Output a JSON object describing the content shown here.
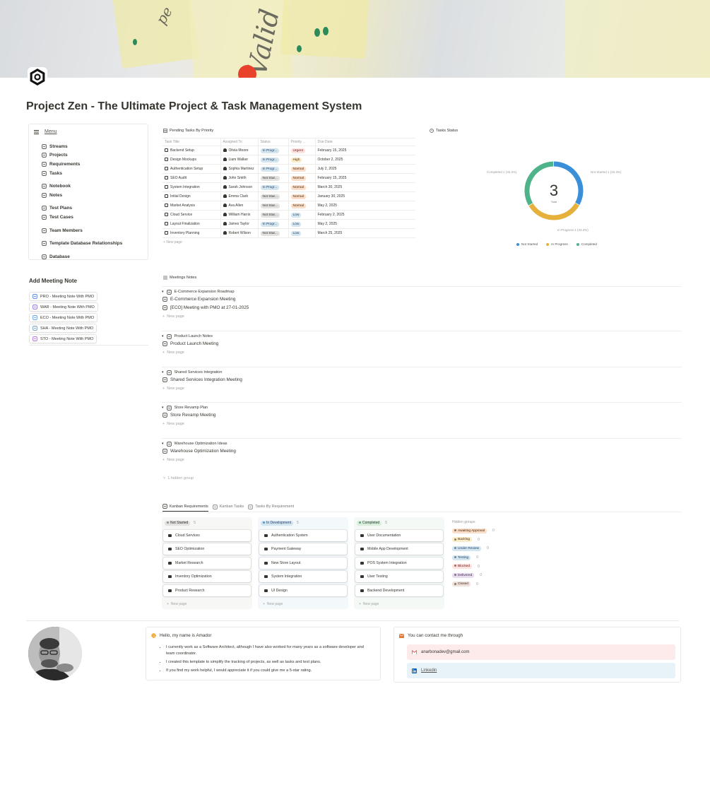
{
  "page": {
    "title": "Project Zen - The Ultimate Project & Task Management System"
  },
  "menu": {
    "label": "Menu",
    "groups": [
      [
        "Streams",
        "Projects",
        "Requirements",
        "Tasks"
      ],
      [
        "Notebook",
        "Notes"
      ],
      [
        "Test Plans",
        "Test Cases"
      ],
      [
        "Team Members"
      ],
      [
        "Template Database Relationships"
      ],
      [
        "Database"
      ]
    ]
  },
  "add_meeting_note": {
    "title": "Add Meeting Note",
    "buttons": [
      "PRO - Meeting Note With PMO",
      "WAR - Meeting Note With PMO",
      "ECO - Meeting Note With PMO",
      "SHA - Meeting Note With PMO",
      "STO - Meeting Note With PMO"
    ]
  },
  "pending_tasks": {
    "view_title": "Pending Tasks By Priority",
    "columns": [
      "Task Title",
      "Assigned To",
      "Status",
      "Priority ...",
      "Due Date"
    ],
    "rows": [
      {
        "title": "Backend Setup",
        "assignee": "Olivia Moore",
        "status": "In Progr...",
        "status_kind": "inprog",
        "priority": "Urgent",
        "priority_kind": "urgent",
        "due": "February 15, 2025"
      },
      {
        "title": "Design Mockups",
        "assignee": "Liam Walker",
        "status": "In Progr...",
        "status_kind": "inprog",
        "priority": "High",
        "priority_kind": "high",
        "due": "October 2, 2025"
      },
      {
        "title": "Authentication Setup",
        "assignee": "Sophia Martinez",
        "status": "In Progr...",
        "status_kind": "inprog",
        "priority": "Normal",
        "priority_kind": "normal",
        "due": "July 2, 2025"
      },
      {
        "title": "SEO Audit",
        "assignee": "John Smith",
        "status": "Not Star...",
        "status_kind": "notstart",
        "priority": "Normal",
        "priority_kind": "normal",
        "due": "February 15, 2025"
      },
      {
        "title": "System Integration",
        "assignee": "Sarah Johnson",
        "status": "In Progr...",
        "status_kind": "inprog",
        "priority": "Normal",
        "priority_kind": "normal",
        "due": "March 30, 2025"
      },
      {
        "title": "Initial Design",
        "assignee": "Emma Clark",
        "status": "Not Star...",
        "status_kind": "notstart",
        "priority": "Normal",
        "priority_kind": "normal",
        "due": "January 30, 2025"
      },
      {
        "title": "Market Analysis",
        "assignee": "Ava Allen",
        "status": "Not Star...",
        "status_kind": "notstart",
        "priority": "Normal",
        "priority_kind": "normal",
        "due": "May 2, 2025"
      },
      {
        "title": "Cloud Service",
        "assignee": "William Harris",
        "status": "Not Star...",
        "status_kind": "notstart",
        "priority": "Low",
        "priority_kind": "low",
        "due": "February 2, 2025"
      },
      {
        "title": "Layout Finalization",
        "assignee": "James Taylor",
        "status": "In Progr...",
        "status_kind": "inprog",
        "priority": "Low",
        "priority_kind": "low",
        "due": "May 2, 2025"
      },
      {
        "title": "Inventory Planning",
        "assignee": "Robert Wilson",
        "status": "Not Star...",
        "status_kind": "notstart",
        "priority": "Low",
        "priority_kind": "low",
        "due": "March 25, 2025"
      }
    ],
    "new_page": "New page"
  },
  "tasks_status": {
    "view_title": "Tasks Status",
    "total_value": "3",
    "total_label": "Total",
    "slice_labels": [
      "Completed 1 (33.3%)",
      "Not Started 1 (33.3%)",
      "In Progress 1 (33.3%)"
    ],
    "legend": [
      "Not Started",
      "In Progress",
      "Completed"
    ]
  },
  "chart_data": {
    "type": "pie",
    "title": "Tasks Status",
    "categories": [
      "Not Started",
      "In Progress",
      "Completed"
    ],
    "values": [
      1,
      1,
      1
    ],
    "colors": [
      "#3b8fd9",
      "#e5b13c",
      "#4fb38a"
    ],
    "total": 3
  },
  "meeting_notes": {
    "view_title": "Meetings Notes",
    "groups": [
      {
        "name": "E-Commerce Expansion Roadmap",
        "items": [
          "E-Commerce Expansion Meeting",
          "[ECO] Meeting with PMO at 27-01-2025"
        ]
      },
      {
        "name": "Product Launch Notes",
        "items": [
          "Product Launch Meeting"
        ]
      },
      {
        "name": "Shared Services Integration",
        "items": [
          "Shared Services Integration Meeting"
        ]
      },
      {
        "name": "Store Revamp Plan",
        "items": [
          "Store Revamp Meeting"
        ]
      },
      {
        "name": "Warehouse Optimization Ideas",
        "items": [
          "Warehouse Optimization Meeting"
        ]
      }
    ],
    "new_page": "New page",
    "hidden_group": "1 hidden group"
  },
  "kanban": {
    "tabs": [
      "Kanban Requirements",
      "Kanban Tasks",
      "Tasks By Requirement"
    ],
    "columns": [
      {
        "name": "Not Started",
        "count": "5",
        "cards": [
          "Cloud Services",
          "SEO Optimization",
          "Market Research",
          "Inventory Optimization",
          "Product Research"
        ]
      },
      {
        "name": "In Development",
        "count": "5",
        "cards": [
          "Authentication System",
          "Payment Gateway",
          "New Store Layout",
          "System Integration",
          "UI Design"
        ]
      },
      {
        "name": "Completed",
        "count": "5",
        "cards": [
          "User Documentation",
          "Mobile App Development",
          "POS System Integration",
          "User Testing",
          "Backend Development"
        ]
      }
    ],
    "new_page": "New page",
    "hidden_groups_title": "Hidden groups",
    "hidden_groups": [
      {
        "name": "Awaiting Approval",
        "count": "0",
        "bg": "#fadec9",
        "fg": "#49290e"
      },
      {
        "name": "Backlog",
        "count": "0",
        "bg": "#fdecc8",
        "fg": "#402c1b"
      },
      {
        "name": "Under Review",
        "count": "0",
        "bg": "#d3e5ef",
        "fg": "#28456c"
      },
      {
        "name": "Testing",
        "count": "0",
        "bg": "#d3e5ef",
        "fg": "#28456c"
      },
      {
        "name": "Blocked",
        "count": "0",
        "bg": "#ffe2dd",
        "fg": "#5d1715"
      },
      {
        "name": "Delivered",
        "count": "0",
        "bg": "#e8deee",
        "fg": "#412454"
      },
      {
        "name": "Closed",
        "count": "0",
        "bg": "#eee0da",
        "fg": "#442a1e"
      }
    ]
  },
  "about": {
    "heading": "Hello, my name is Amador",
    "bullets": [
      "I currently work as a Software Architect, although I have also worked for many years as a software developer and team coordinator.",
      "I created this template to simplify the tracking of projects, as well as tasks and test plans.",
      "If you find my work helpful, I would appreciate it if you could give me a 5-star rating."
    ]
  },
  "contact": {
    "heading": "You can contact me through",
    "email": "anarbonadev@gmail.com",
    "linkedin": "Linkedin"
  }
}
